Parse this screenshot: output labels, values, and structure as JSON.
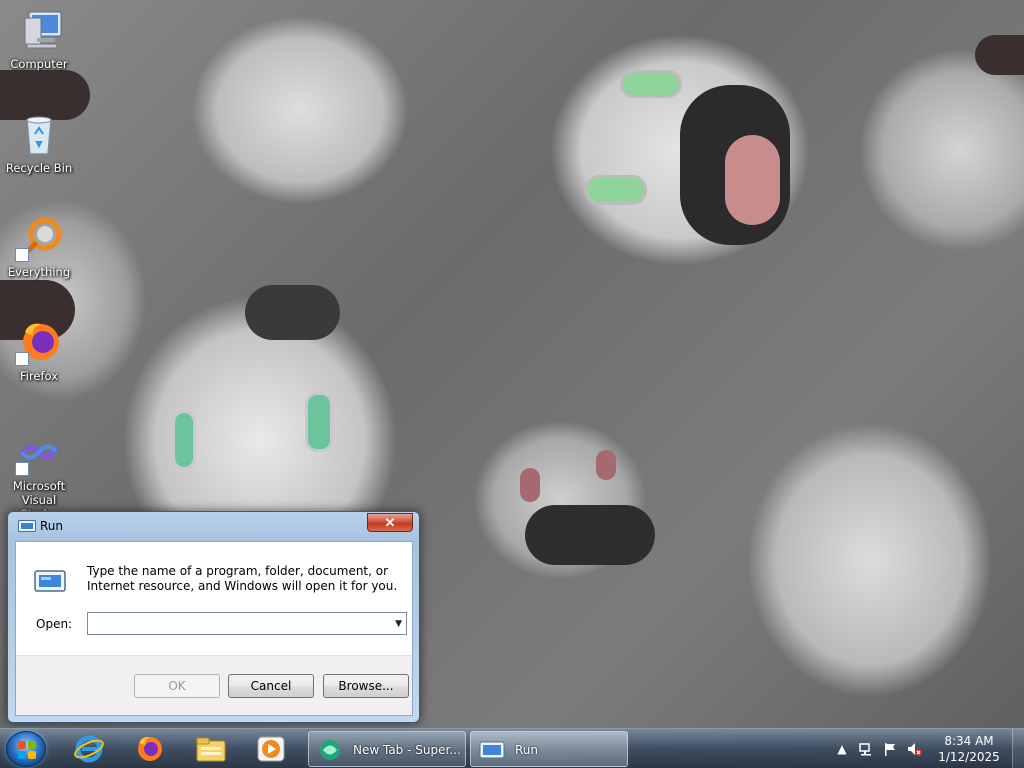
{
  "desktop": {
    "icons": [
      {
        "label": "Computer",
        "icon": "computer-icon"
      },
      {
        "label": "Recycle Bin",
        "icon": "recycle-bin-icon"
      },
      {
        "label": "Everything",
        "icon": "everything-search-icon"
      },
      {
        "label": "Firefox",
        "icon": "firefox-icon"
      },
      {
        "label": "Microsoft Visual Stud...",
        "icon": "visual-studio-icon"
      }
    ]
  },
  "run_dialog": {
    "title": "Run",
    "close_label": "✕",
    "description": "Type the name of a program, folder, document, or Internet resource, and Windows will open it for you.",
    "open_label": "Open:",
    "open_value": "",
    "buttons": {
      "ok": "OK",
      "cancel": "Cancel",
      "browse": "Browse..."
    }
  },
  "taskbar": {
    "pinned": [
      "internet-explorer-icon",
      "firefox-icon",
      "file-explorer-icon",
      "media-player-icon"
    ],
    "tasks": [
      {
        "label": "New Tab - Super...",
        "icon": "browser-icon"
      },
      {
        "label": "Run",
        "icon": "run-icon"
      }
    ],
    "tray": {
      "time": "8:34 AM",
      "date": "1/12/2025",
      "show_hidden": "▲"
    }
  },
  "colors": {
    "taskbar": "#3c4b5f",
    "window_frame": "#b9d1ea",
    "close_button": "#c23a22"
  }
}
